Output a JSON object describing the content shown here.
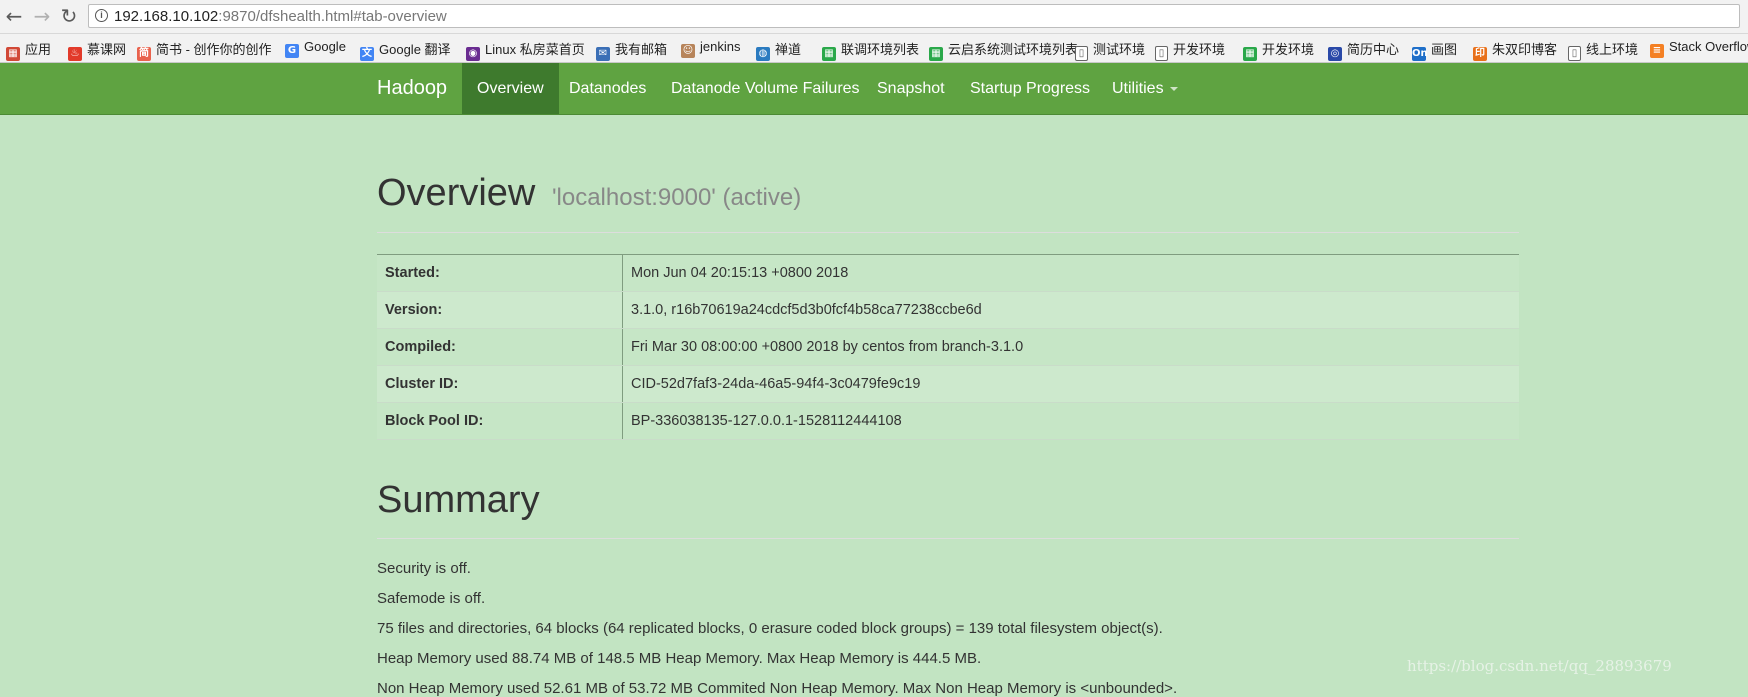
{
  "browser": {
    "url_host": "192.168.10.102",
    "url_path": ":9870/dfshealth.html#tab-overview"
  },
  "bookmarks": [
    {
      "icon": "apps-icon",
      "label": "应用",
      "color": "#d14836"
    },
    {
      "icon": "flame-icon",
      "label": "慕课网",
      "color": "#e23a2a"
    },
    {
      "icon": "jianshu-icon",
      "label": "简书 - 创作你的创作",
      "color": "#e9624d"
    },
    {
      "icon": "google-icon",
      "label": "Google",
      "color": "#4285f4"
    },
    {
      "icon": "translate-icon",
      "label": "Google 翻译",
      "color": "#4285f4"
    },
    {
      "icon": "linux-icon",
      "label": "Linux 私房菜首页",
      "color": "#6a2c91"
    },
    {
      "icon": "mail-icon",
      "label": "我有邮箱",
      "color": "#3b6fb6"
    },
    {
      "icon": "jenkins-icon",
      "label": "jenkins",
      "color": "#b7845a"
    },
    {
      "icon": "globe-icon",
      "label": "禅道",
      "color": "#2b7bc0"
    },
    {
      "icon": "grid-icon",
      "label": "联调环境列表",
      "color": "#2aa84a"
    },
    {
      "icon": "grid-icon",
      "label": "云启系统测试环境列表",
      "color": "#2aa84a"
    },
    {
      "icon": "page-icon",
      "label": "测试环境",
      "color": "#ffffff"
    },
    {
      "icon": "page-icon",
      "label": "开发环境",
      "color": "#ffffff"
    },
    {
      "icon": "grid-icon",
      "label": "开发环境",
      "color": "#2aa84a"
    },
    {
      "icon": "resume-icon",
      "label": "简历中心",
      "color": "#2a49a8"
    },
    {
      "icon": "on-icon",
      "label": "画图",
      "color": "#1f6fc9"
    },
    {
      "icon": "print-icon",
      "label": "朱双印博客",
      "color": "#e8701a"
    },
    {
      "icon": "page-icon",
      "label": "线上环境",
      "color": "#ffffff"
    },
    {
      "icon": "stack-icon",
      "label": "Stack Overflow",
      "color": "#f48024"
    }
  ],
  "navbar": {
    "brand": "Hadoop",
    "tabs": [
      {
        "label": "Overview",
        "active": true
      },
      {
        "label": "Datanodes"
      },
      {
        "label": "Datanode Volume Failures"
      },
      {
        "label": "Snapshot"
      },
      {
        "label": "Startup Progress"
      },
      {
        "label": "Utilities"
      }
    ]
  },
  "overview": {
    "title": "Overview",
    "subtitle": "'localhost:9000' (active)",
    "rows": [
      {
        "key": "Started:",
        "value": "Mon Jun 04 20:15:13 +0800 2018"
      },
      {
        "key": "Version:",
        "value": "3.1.0, r16b70619a24cdcf5d3b0fcf4b58ca77238ccbe6d"
      },
      {
        "key": "Compiled:",
        "value": "Fri Mar 30 08:00:00 +0800 2018 by centos from branch-3.1.0"
      },
      {
        "key": "Cluster ID:",
        "value": "CID-52d7faf3-24da-46a5-94f4-3c0479fe9c19"
      },
      {
        "key": "Block Pool ID:",
        "value": "BP-336038135-127.0.0.1-1528112444108"
      }
    ]
  },
  "summary": {
    "title": "Summary",
    "lines": [
      "Security is off.",
      "Safemode is off.",
      "75 files and directories, 64 blocks (64 replicated blocks, 0 erasure coded block groups) = 139 total filesystem object(s).",
      "Heap Memory used 88.74 MB of 148.5 MB Heap Memory. Max Heap Memory is 444.5 MB.",
      "Non Heap Memory used 52.61 MB of 53.72 MB Commited Non Heap Memory. Max Non Heap Memory is <unbounded>."
    ]
  },
  "watermark": "https://blog.csdn.net/qq_28893679"
}
